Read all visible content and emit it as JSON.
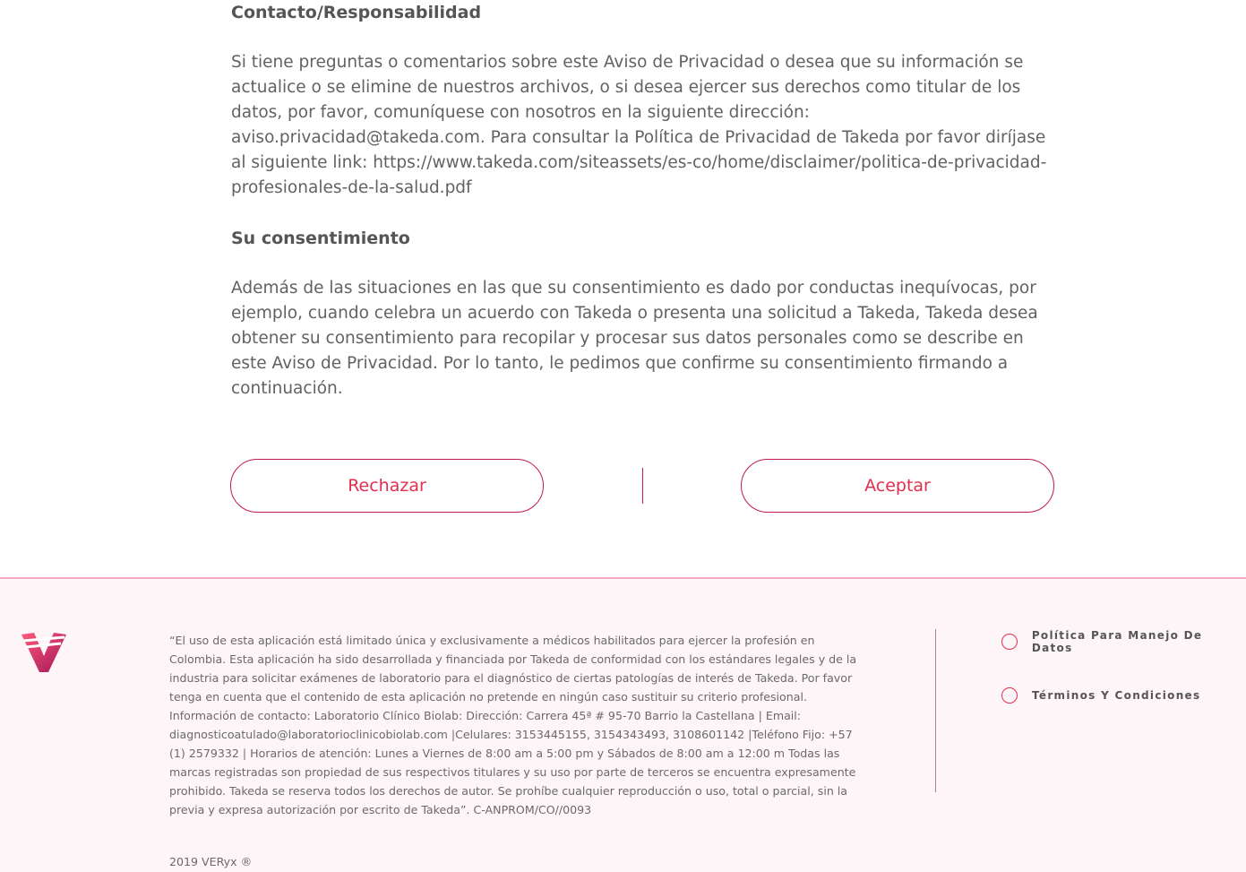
{
  "sections": {
    "contact_heading": "Contacto/Responsabilidad",
    "contact_text": "Si tiene preguntas o comentarios sobre este Aviso de Privacidad o desea que su información se actualice o se elimine de nuestros archivos, o si desea ejercer sus derechos como titular de los datos, por favor, comuníquese con nosotros en la siguiente dirección: aviso.privacidad@takeda.com. Para consultar la Política de Privacidad de Takeda por favor diríjase al siguiente link: https://www.takeda.com/siteassets/es-co/home/disclaimer/politica-de-privacidad-profesionales-de-la-salud.pdf",
    "consent_heading": "Su consentimiento",
    "consent_text": "Además de las situaciones en las que su consentimiento es dado por conductas inequívocas, por ejemplo, cuando celebra un acuerdo con Takeda o presenta una solicitud a Takeda, Takeda desea obtener su consentimiento para recopilar y procesar sus datos personales como se describe en este Aviso de Privacidad. Por lo tanto, le pedimos que confirme su consentimiento firmando a continuación."
  },
  "actions": {
    "reject_label": "Rechazar",
    "accept_label": "Aceptar"
  },
  "footer": {
    "disclaimer": "“El uso de esta aplicación está limitado única y exclusivamente a médicos habilitados para ejercer la profesión en Colombia. Esta aplicación ha sido desarrollada y financiada por Takeda de conformidad con los estándares legales y de la industria para solicitar exámenes de laboratorio para el diagnóstico de ciertas patologías de interés de Takeda. Por favor tenga en cuenta que el contenido de esta aplicación no pretende en ningún caso sustituir su criterio profesional. Información de contacto: Laboratorio Clínico Biolab: Dirección: Carrera 45ª # 95-70 Barrio la Castellana | Email: diagnosticoatulado@laboratorioclinicobiolab.com |Celulares: 3153445155, 3154343493, 3108601142 |Teléfono Fijo: +57 (1) 2579332 | Horarios de atención: Lunes a Viernes de 8:00 am a 5:00 pm y Sábados de 8:00 am a 12:00 m Todas las marcas registradas son propiedad de sus respectivos titulares y su uso por parte de terceros se encuentra expresamente prohibido. Takeda se reserva todos los derechos de autor. Se prohíbe cualquier reproducción o uso, total o parcial, sin la previa y expresa autorización por escrito de Takeda”. C-ANPROM/CO//0093",
    "copyright": "2019 VERyx ®",
    "links": [
      "Política Para Manejo De Datos",
      "Términos Y Condiciones"
    ],
    "logo_icon": "veryx-logo-icon"
  },
  "colors": {
    "accent": "#e0304e",
    "border": "#c2185b",
    "footer_bg": "#fdf5f8"
  }
}
